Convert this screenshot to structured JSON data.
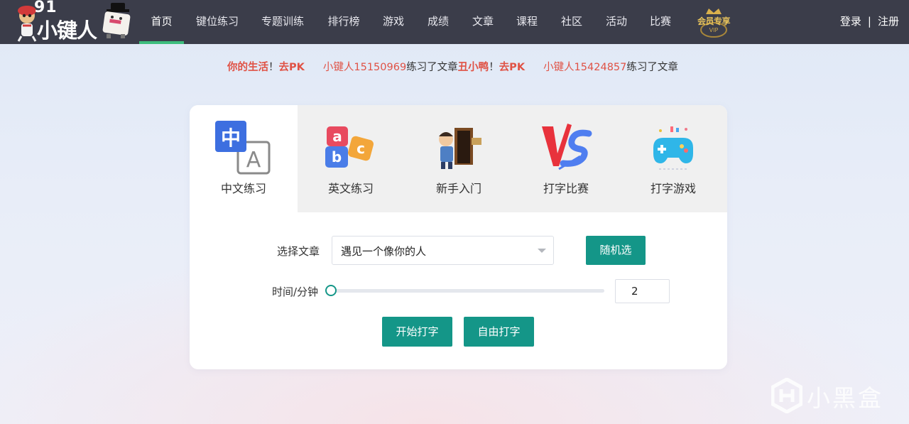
{
  "logo": {
    "number": "91",
    "brand": "小键人"
  },
  "nav": {
    "items": [
      {
        "label": "首页",
        "active": true
      },
      {
        "label": "键位练习"
      },
      {
        "label": "专题训练"
      },
      {
        "label": "排行榜"
      },
      {
        "label": "游戏"
      },
      {
        "label": "成绩"
      },
      {
        "label": "文章"
      },
      {
        "label": "课程"
      },
      {
        "label": "社区"
      },
      {
        "label": "活动"
      },
      {
        "label": "比赛"
      }
    ],
    "vip_text": "会员专享",
    "vip_sub": "VIP",
    "login": "登录",
    "separator": "|",
    "register": "注册",
    "accent_color": "#3dbd7d"
  },
  "ticker": {
    "segments": [
      {
        "text": "你的生活",
        "style": "red"
      },
      {
        "text": "！",
        "style": "dark"
      },
      {
        "text": "去PK",
        "style": "red"
      },
      {
        "text": "小键人15150969",
        "style": "user"
      },
      {
        "text": "练习了文章",
        "style": "dark"
      },
      {
        "text": "丑小鸭",
        "style": "red"
      },
      {
        "text": "！",
        "style": "dark"
      },
      {
        "text": "去PK",
        "style": "red"
      },
      {
        "text": "小键人15424857",
        "style": "user"
      },
      {
        "text": "练习了文章",
        "style": "dark"
      }
    ]
  },
  "tabs": [
    {
      "label": "中文练习",
      "icon": "chinese-practice-icon",
      "active": true
    },
    {
      "label": "英文练习",
      "icon": "english-practice-icon"
    },
    {
      "label": "新手入门",
      "icon": "beginner-guide-icon"
    },
    {
      "label": "打字比赛",
      "icon": "typing-contest-icon"
    },
    {
      "label": "打字游戏",
      "icon": "typing-game-icon"
    }
  ],
  "form": {
    "article_label": "选择文章",
    "article_value": "遇见一个像你的人",
    "random_button": "随机选",
    "time_label": "时间/分钟",
    "time_value": "2",
    "slider_fraction": 0.0,
    "start_button": "开始打字",
    "free_button": "自由打字",
    "button_color": "#149688"
  },
  "watermark": {
    "text": "小黑盒"
  }
}
